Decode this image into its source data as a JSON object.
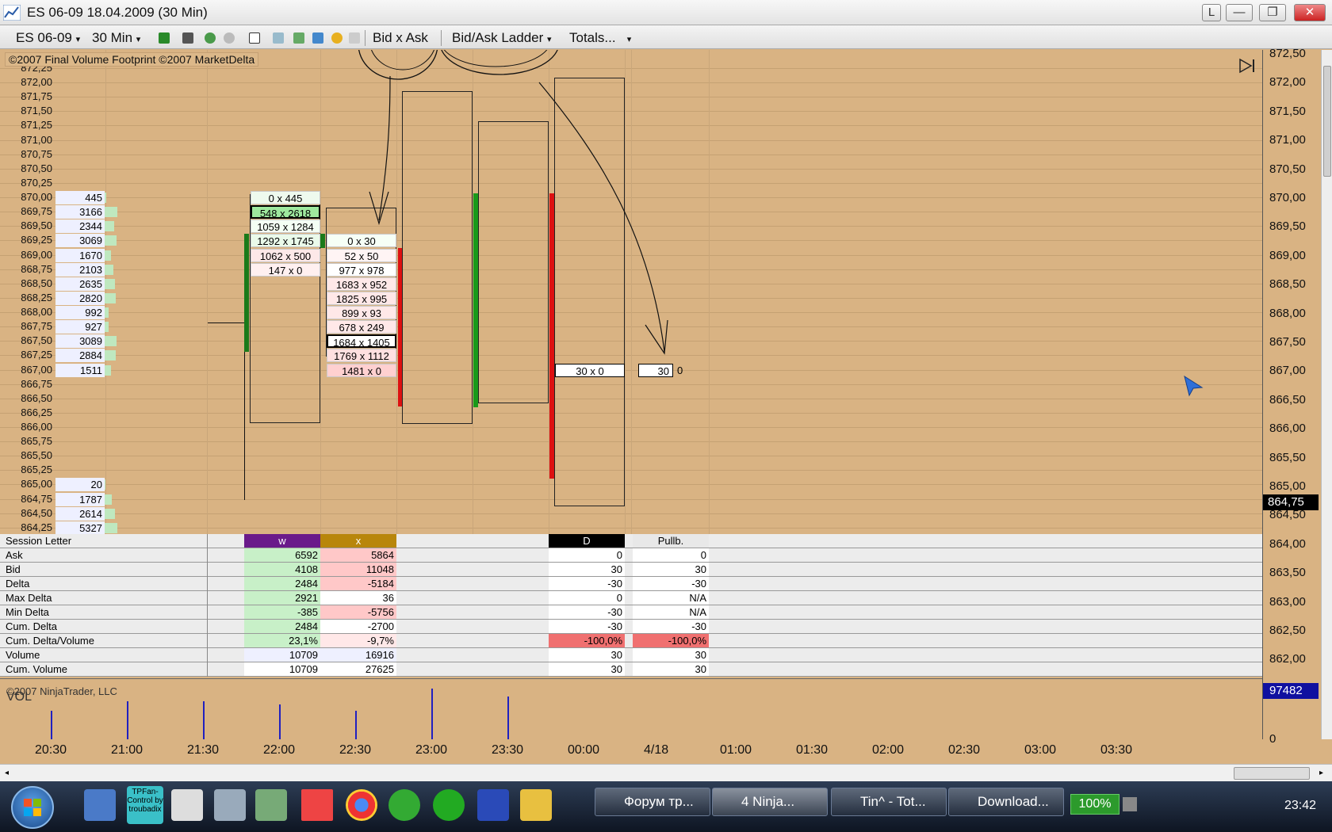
{
  "window": {
    "title": "ES 06-09  18.04.2009 (30 Min)",
    "buttons": [
      "L",
      "—",
      "❐",
      "✕"
    ]
  },
  "toolbar": {
    "instrument": "ES 06-09",
    "period": "30 Min",
    "bid_x_ask": "Bid x Ask",
    "ladder": "Bid/Ask Ladder",
    "totals": "Totals..."
  },
  "chart": {
    "copyright": "©2007 Final Volume Footprint ©2007 MarketDelta",
    "last_price": "864,75",
    "price_labels": [
      "872,25",
      "872,00",
      "871,75",
      "871,50",
      "871,25",
      "871,00",
      "870,75",
      "870,50",
      "870,25",
      "870,00",
      "869,75",
      "869,50",
      "869,25",
      "869,00",
      "868,75",
      "868,50",
      "868,25",
      "868,00",
      "867,75",
      "867,50",
      "867,25",
      "867,00",
      "866,75",
      "866,50",
      "866,25",
      "866,00",
      "865,75",
      "865,50",
      "865,25",
      "865,00",
      "864,75",
      "864,50",
      "864,25"
    ],
    "volume_profile": [
      {
        "p": "870,00",
        "v": "445"
      },
      {
        "p": "869,75",
        "v": "3166"
      },
      {
        "p": "869,50",
        "v": "2344"
      },
      {
        "p": "869,25",
        "v": "3069"
      },
      {
        "p": "869,00",
        "v": "1670"
      },
      {
        "p": "868,75",
        "v": "2103"
      },
      {
        "p": "868,50",
        "v": "2635"
      },
      {
        "p": "868,25",
        "v": "2820"
      },
      {
        "p": "868,00",
        "v": "992"
      },
      {
        "p": "867,75",
        "v": "927"
      },
      {
        "p": "867,50",
        "v": "3089"
      },
      {
        "p": "867,25",
        "v": "2884"
      },
      {
        "p": "867,00",
        "v": "1511"
      },
      {
        "p": "865,00",
        "v": "20"
      },
      {
        "p": "864,75",
        "v": "1787"
      },
      {
        "p": "864,50",
        "v": "2614"
      },
      {
        "p": "864,25",
        "v": "5327"
      }
    ],
    "bar_w": [
      "0 x 445",
      "548 x 2618",
      "1059 x 1284",
      "1292 x 1745",
      "1062 x 500",
      "147 x 0"
    ],
    "bar_x": [
      "0 x 30",
      "52 x 50",
      "977 x 978",
      "1683 x 952",
      "1825 x 995",
      "899 x 93",
      "678 x 249",
      "1684 x 1405",
      "1769 x 1112",
      "1481 x 0"
    ],
    "bar_d": "30 x 0",
    "bar_pull": "30",
    "bar_pull_extra": "0"
  },
  "axis_labels": [
    "872,50",
    "872,00",
    "871,50",
    "871,00",
    "870,50",
    "870,00",
    "869,50",
    "869,00",
    "868,50",
    "868,00",
    "867,50",
    "867,00",
    "866,50",
    "866,00",
    "865,50",
    "865,00",
    "864,50",
    "864,00",
    "863,50",
    "863,00",
    "862,50",
    "862,00"
  ],
  "stats": {
    "headers": {
      "label": "Session Letter",
      "w": "w",
      "x": "x",
      "d": "D",
      "p": "Pullb."
    },
    "rows": [
      {
        "label": "Ask",
        "w": "6592",
        "x": "5864",
        "d": "0",
        "p": "0"
      },
      {
        "label": "Bid",
        "w": "4108",
        "x": "11048",
        "d": "30",
        "p": "30"
      },
      {
        "label": "Delta",
        "w": "2484",
        "x": "-5184",
        "d": "-30",
        "p": "-30"
      },
      {
        "label": "Max Delta",
        "w": "2921",
        "x": "36",
        "d": "0",
        "p": "N/A"
      },
      {
        "label": "Min Delta",
        "w": "-385",
        "x": "-5756",
        "d": "-30",
        "p": "N/A"
      },
      {
        "label": "Cum. Delta",
        "w": "2484",
        "x": "-2700",
        "d": "-30",
        "p": "-30"
      },
      {
        "label": "Cum. Delta/Volume",
        "w": "23,1%",
        "x": "-9,7%",
        "d": "-100,0%",
        "p": "-100,0%"
      },
      {
        "label": "Volume",
        "w": "10709",
        "x": "16916",
        "d": "30",
        "p": "30"
      },
      {
        "label": "Cum. Volume",
        "w": "10709",
        "x": "27625",
        "d": "30",
        "p": "30"
      }
    ]
  },
  "volume_panel": {
    "label": "VOL",
    "copyright": "©2007 NinjaTrader, LLC",
    "max": "97482",
    "zero": "0"
  },
  "time_labels": [
    "20:30",
    "21:00",
    "21:30",
    "22:00",
    "22:30",
    "23:00",
    "23:30",
    "00:00",
    "4/18",
    "01:00",
    "01:30",
    "02:00",
    "02:30",
    "03:00",
    "03:30"
  ],
  "taskbar": {
    "tasks": [
      "Форум тр...",
      "4 Ninja...",
      "Tin^ - Tot...",
      "Download..."
    ],
    "zoom": "100%",
    "clock": "23:42",
    "tpfan": "TPFan-Control by troubadix"
  }
}
